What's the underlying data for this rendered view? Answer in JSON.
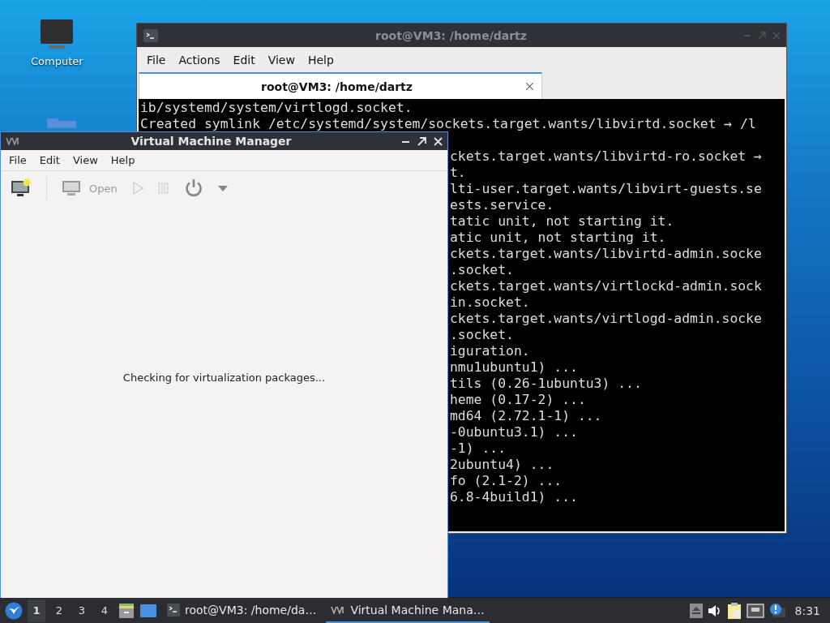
{
  "desktop": {
    "icons": [
      {
        "label": "Computer"
      }
    ]
  },
  "terminal": {
    "title": "root@VM3: /home/dartz",
    "active": false,
    "menu": [
      "File",
      "Actions",
      "Edit",
      "View",
      "Help"
    ],
    "tabs": [
      {
        "label": "root@VM3: /home/dartz",
        "selected": true
      }
    ],
    "lines": [
      "ib/systemd/system/virtlogd.socket.",
      "Created symlink /etc/systemd/system/sockets.target.wants/libvirtd.socket → /l"
    ],
    "partial_lines": [
      "ckets.target.wants/libvirtd-ro.socket →",
      "t.",
      "lti-user.target.wants/libvirt-guests.se",
      "ests.service.",
      "tatic unit, not starting it.",
      "atic unit, not starting it.",
      "ckets.target.wants/libvirtd-admin.socke",
      ".socket.",
      "ckets.target.wants/virtlockd-admin.sock",
      "in.socket.",
      "ckets.target.wants/virtlogd-admin.socke",
      ".socket.",
      "iguration.",
      "nmu1ubuntu1) ...",
      "tils (0.26-1ubuntu3) ...",
      "heme (0.17-2) ...",
      "md64 (2.72.1-1) ...",
      "-0ubuntu3.1) ...",
      "-1) ...",
      "2ubuntu4) ...",
      "fo (2.1-2) ...",
      "6.8-4build1) ..."
    ]
  },
  "vmm": {
    "title": "Virtual Machine Manager",
    "active": true,
    "menu": [
      "File",
      "Edit",
      "View",
      "Help"
    ],
    "open_button": {
      "label": "Open",
      "disabled": true
    },
    "status": "Checking for virtualization packages..."
  },
  "taskbar": {
    "workspaces": [
      {
        "label": "1",
        "selected": true
      },
      {
        "label": "2",
        "selected": false
      },
      {
        "label": "3",
        "selected": false
      },
      {
        "label": "4",
        "selected": false
      }
    ],
    "tasks": [
      {
        "label": "root@VM3: /home/da…",
        "kind": "terminal",
        "selected": false
      },
      {
        "label": "Virtual Machine Mana…",
        "kind": "vmm",
        "selected": true
      }
    ],
    "clock": "8:31"
  }
}
